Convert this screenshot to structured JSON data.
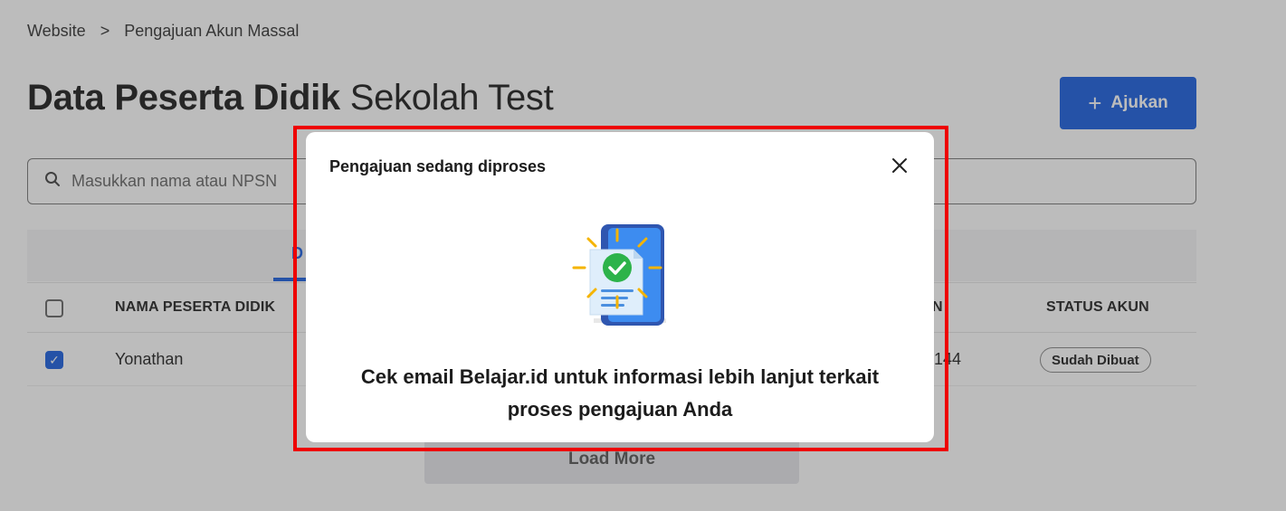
{
  "breadcrumb": {
    "items": [
      "Website",
      "Pengajuan Akun Massal"
    ],
    "separator": ">"
  },
  "header": {
    "title_bold": "Data Peserta Didik",
    "title_school": "Sekolah Test",
    "action_label": "Ajukan",
    "action_icon": "plus-icon"
  },
  "search": {
    "placeholder": "Masukkan nama atau NPSN",
    "icon": "search-icon"
  },
  "tabs": {
    "active_label": "D"
  },
  "table": {
    "columns": [
      "NAMA PESERTA DIDIK",
      "N",
      "STATUS AKUN"
    ],
    "rows": [
      {
        "checked": true,
        "name": "Yonathan",
        "number": "144",
        "status": "Sudah Dibuat"
      }
    ]
  },
  "pagination": {
    "load_more_label": "Load More"
  },
  "modal": {
    "title": "Pengajuan sedang diproses",
    "close_icon": "close-icon",
    "illustration": "document-check-icon",
    "message": "Cek email Belajar.id untuk informasi lebih lanjut terkait proses pengajuan Anda"
  },
  "colors": {
    "accent": "#1a5fe0",
    "highlight": "#ee0000",
    "check_green": "#2db34a",
    "spark_yellow": "#f5b400"
  }
}
